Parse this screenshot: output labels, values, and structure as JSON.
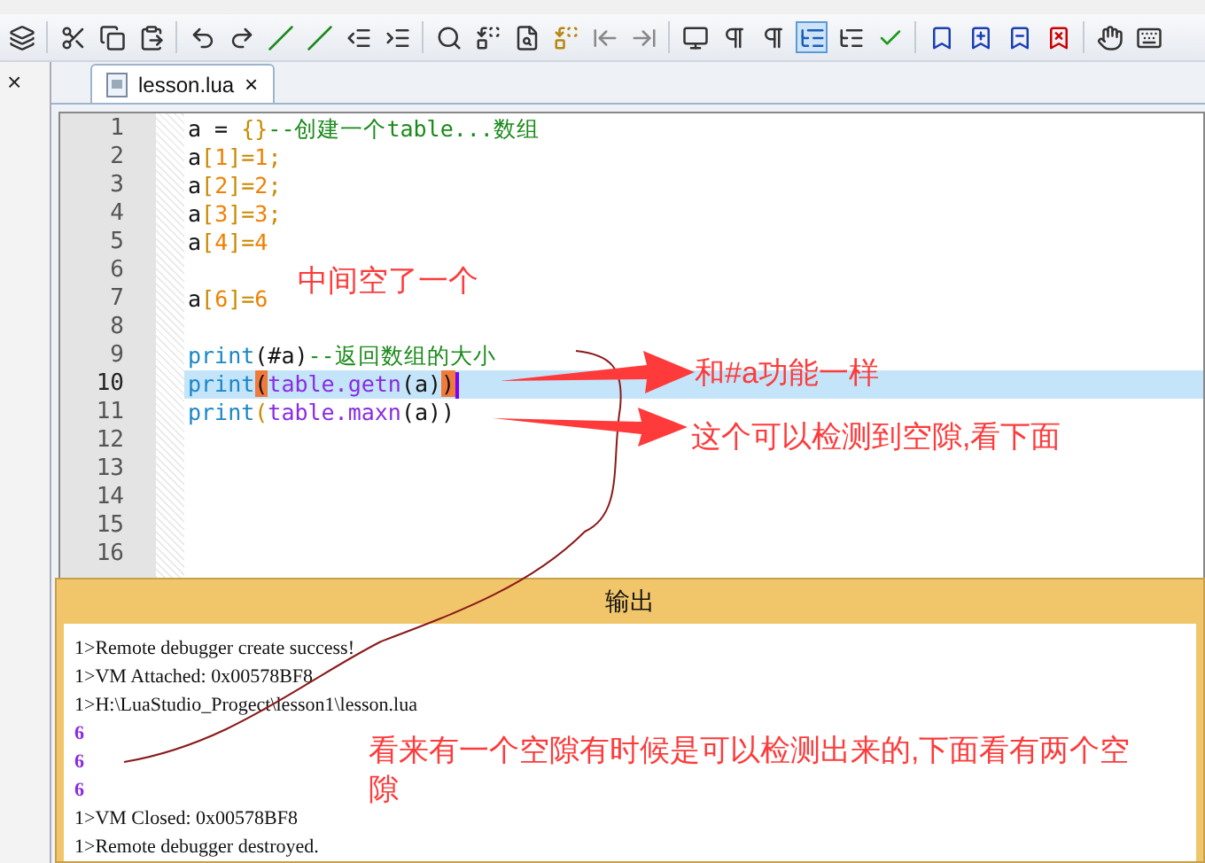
{
  "side_pane": {
    "close": "×"
  },
  "tabs": [
    {
      "label": "lesson.lua",
      "close": "×",
      "selected": true
    }
  ],
  "editor": {
    "lines": [
      {
        "number": "1",
        "current": false,
        "tokens": [
          {
            "text": "a = ",
            "kind": "plain"
          },
          {
            "text": "{}",
            "kind": "bracket"
          },
          {
            "text": "--创建一个table...数组",
            "kind": "comment"
          }
        ]
      },
      {
        "number": "2",
        "current": false,
        "tokens": [
          {
            "text": "a",
            "kind": "plain"
          },
          {
            "text": "[",
            "kind": "bracket"
          },
          {
            "text": "1",
            "kind": "number"
          },
          {
            "text": "]=",
            "kind": "bracket"
          },
          {
            "text": "1",
            "kind": "number"
          },
          {
            "text": ";",
            "kind": "bracket"
          }
        ]
      },
      {
        "number": "3",
        "current": false,
        "tokens": [
          {
            "text": "a",
            "kind": "plain"
          },
          {
            "text": "[",
            "kind": "bracket"
          },
          {
            "text": "2",
            "kind": "number"
          },
          {
            "text": "]=",
            "kind": "bracket"
          },
          {
            "text": "2",
            "kind": "number"
          },
          {
            "text": ";",
            "kind": "bracket"
          }
        ]
      },
      {
        "number": "4",
        "current": false,
        "tokens": [
          {
            "text": "a",
            "kind": "plain"
          },
          {
            "text": "[",
            "kind": "bracket"
          },
          {
            "text": "3",
            "kind": "number"
          },
          {
            "text": "]=",
            "kind": "bracket"
          },
          {
            "text": "3",
            "kind": "number"
          },
          {
            "text": ";",
            "kind": "bracket"
          }
        ]
      },
      {
        "number": "5",
        "current": false,
        "tokens": [
          {
            "text": "a",
            "kind": "plain"
          },
          {
            "text": "[",
            "kind": "bracket"
          },
          {
            "text": "4",
            "kind": "number"
          },
          {
            "text": "]=",
            "kind": "bracket"
          },
          {
            "text": "4",
            "kind": "number"
          }
        ]
      },
      {
        "number": "6",
        "current": false
      },
      {
        "number": "7",
        "current": false,
        "tokens": [
          {
            "text": "a",
            "kind": "plain"
          },
          {
            "text": "[",
            "kind": "bracket"
          },
          {
            "text": "6",
            "kind": "number"
          },
          {
            "text": "]=",
            "kind": "bracket"
          },
          {
            "text": "6",
            "kind": "number"
          }
        ]
      },
      {
        "number": "8",
        "current": false
      },
      {
        "number": "9",
        "current": false,
        "tokens": [
          {
            "text": "print",
            "kind": "keyword"
          },
          {
            "text": "(#a)",
            "kind": "plain"
          },
          {
            "text": "--返回数组的大小",
            "kind": "comment"
          }
        ]
      },
      {
        "number": "10",
        "current": true,
        "tokens": [
          {
            "text": "print",
            "kind": "keyword"
          },
          {
            "text": "(",
            "kind": "match"
          },
          {
            "text": "table.getn",
            "kind": "function"
          },
          {
            "text": "(a)",
            "kind": "plain"
          },
          {
            "text": ")",
            "kind": "match"
          }
        ]
      },
      {
        "number": "11",
        "current": false,
        "tokens": [
          {
            "text": "print",
            "kind": "keyword"
          },
          {
            "text": "(",
            "kind": "bracket"
          },
          {
            "text": "table.maxn",
            "kind": "function"
          },
          {
            "text": "(a))",
            "kind": "plain"
          }
        ]
      },
      {
        "number": "12",
        "current": false
      },
      {
        "number": "13",
        "current": false
      },
      {
        "number": "14",
        "current": false
      },
      {
        "number": "15",
        "current": false
      },
      {
        "number": "16",
        "current": false
      }
    ]
  },
  "output": {
    "title": "输出",
    "lines": [
      {
        "text": "1>Remote debugger create success!",
        "kind": "log"
      },
      {
        "text": "1>VM Attached: 0x00578BF8",
        "kind": "log"
      },
      {
        "text": "1>H:\\LuaStudio_Progect\\lesson1\\lesson.lua",
        "kind": "log"
      },
      {
        "text": "6",
        "kind": "value"
      },
      {
        "text": "6",
        "kind": "value"
      },
      {
        "text": "6",
        "kind": "value"
      },
      {
        "text": "1>VM Closed: 0x00578BF8",
        "kind": "log"
      },
      {
        "text": "1>Remote debugger destroyed.",
        "kind": "log"
      }
    ]
  },
  "annotations": [
    {
      "text": "中间空了一个"
    },
    {
      "text": "和#a功能一样"
    },
    {
      "text": "这个可以检测到空隙,看下面"
    },
    {
      "text": "看来有一个空隙有时候是可以检测出来的,下面看有两个空隙"
    }
  ]
}
